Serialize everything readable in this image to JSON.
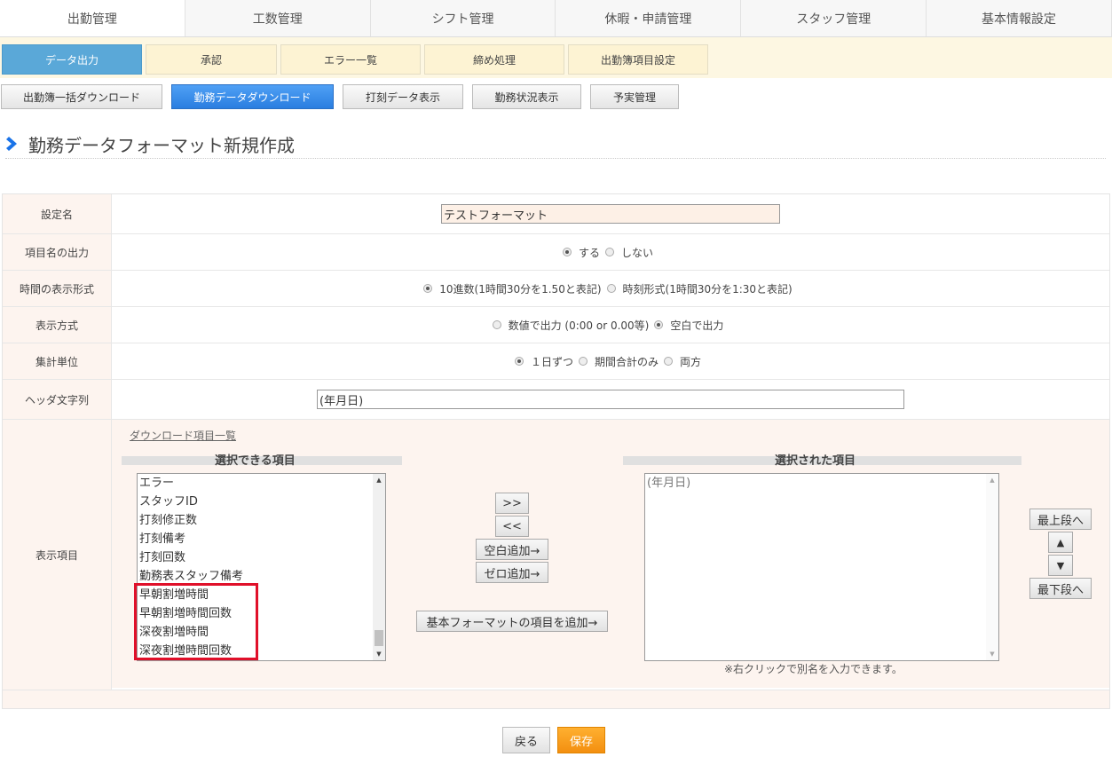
{
  "topnav": {
    "tabs": [
      {
        "label": "出勤管理"
      },
      {
        "label": "工数管理"
      },
      {
        "label": "シフト管理"
      },
      {
        "label": "休暇・申請管理"
      },
      {
        "label": "スタッフ管理"
      },
      {
        "label": "基本情報設定"
      }
    ]
  },
  "subnav": {
    "tabs": [
      {
        "label": "データ出力"
      },
      {
        "label": "承認"
      },
      {
        "label": "エラー一覧"
      },
      {
        "label": "締め処理"
      },
      {
        "label": "出勤簿項目設定"
      }
    ]
  },
  "actions": {
    "buttons": [
      {
        "label": "出勤簿一括ダウンロード"
      },
      {
        "label": "勤務データダウンロード"
      },
      {
        "label": "打刻データ表示"
      },
      {
        "label": "勤務状況表示"
      },
      {
        "label": "予実管理"
      }
    ]
  },
  "page": {
    "title": "勤務データフォーマット新規作成"
  },
  "form": {
    "setting_name": {
      "label": "設定名",
      "value": "テストフォーマット"
    },
    "header_output": {
      "label": "項目名の出力",
      "options": [
        "する",
        "しない"
      ],
      "selected": "する"
    },
    "time_format": {
      "label": "時間の表示形式",
      "options": [
        "10進数(1時間30分を1.50と表記)",
        "時刻形式(1時間30分を1:30と表記)"
      ],
      "selected": "10進数(1時間30分を1.50と表記)"
    },
    "display_mode": {
      "label": "表示方式",
      "options": [
        "数値で出力 (0:00 or 0.00等)",
        "空白で出力"
      ],
      "selected": "空白で出力"
    },
    "aggregation": {
      "label": "集計単位",
      "options": [
        "１日ずつ",
        "期間合計のみ",
        "両方"
      ],
      "selected": "１日ずつ"
    },
    "header_text": {
      "label": "ヘッダ文字列",
      "value": "(年月日)"
    },
    "display_items": {
      "label": "表示項目",
      "download_link": "ダウンロード項目一覧",
      "available_title": "選択できる項目",
      "selected_title": "選択された項目",
      "available_items": [
        "エラー",
        "スタッフID",
        "打刻修正数",
        "打刻備考",
        "打刻回数",
        "勤務表スタッフ備考",
        "早朝割増時間",
        "早朝割増時間回数",
        "深夜割増時間",
        "深夜割増時間回数"
      ],
      "selected_items": [
        "(年月日)"
      ],
      "add_button": ">>",
      "remove_button": "<<",
      "add_blank_button": "空白追加→",
      "add_zero_button": "ゼロ追加→",
      "add_basic_button": "基本フォーマットの項目を追加→",
      "to_top_button": "最上段へ",
      "up_button": "▲",
      "down_button": "▼",
      "to_bottom_button": "最下段へ",
      "note": "※右クリックで別名を入力できます。"
    }
  },
  "footer": {
    "back_label": "戻る",
    "save_label": "保存"
  },
  "colors": {
    "highlight": "#e0102a",
    "active_tab": "#5aa8d8",
    "active_button": "#2a7ee0",
    "save": "#f39a12"
  }
}
